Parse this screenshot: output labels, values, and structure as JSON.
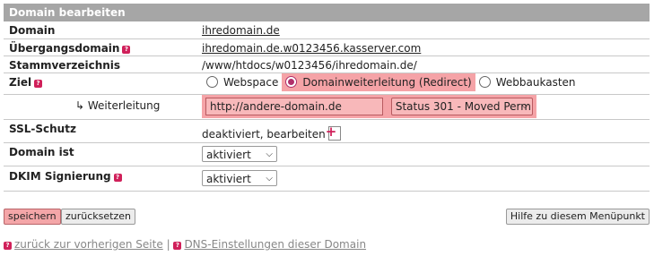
{
  "header": {
    "title": "Domain bearbeiten"
  },
  "rows": {
    "domain": {
      "label": "Domain",
      "value": "ihredomain.de"
    },
    "uebergang": {
      "label": "Übergangsdomain",
      "value": "ihredomain.de.w0123456.kasserver.com"
    },
    "stamm": {
      "label": "Stammverzeichnis",
      "value": "/www/htdocs/w0123456/ihredomain.de/"
    },
    "ziel": {
      "label": "Ziel",
      "options": [
        "Webspace",
        "Domainweiterleitung (Redirect)",
        "Webbaukasten"
      ],
      "selected": "Domainweiterleitung (Redirect)"
    },
    "weiterleitung": {
      "label": "↳ Weiterleitung",
      "url_value": "http://andere-domain.de",
      "status_value": "Status 301 - Moved Perm"
    },
    "ssl": {
      "label": "SSL-Schutz",
      "value": "deaktiviert, bearbeiten"
    },
    "domain_ist": {
      "label": "Domain ist",
      "value": "aktiviert"
    },
    "dkim": {
      "label": "DKIM Signierung",
      "value": "aktiviert"
    }
  },
  "buttons": {
    "save": "speichern",
    "reset": "zurücksetzen",
    "help": "Hilfe zu diesem Menüpunkt"
  },
  "footer": {
    "back": "zurück zur vorherigen Seite",
    "separator": "|",
    "dns": "DNS-Einstellungen dieser Domain"
  },
  "colors": {
    "accent": "#d0205a",
    "highlight": "#f5a3a7",
    "header_bg": "#a6a6a6"
  }
}
